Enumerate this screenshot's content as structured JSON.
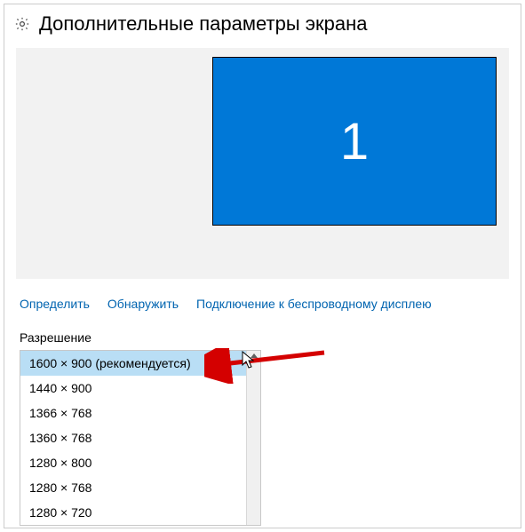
{
  "header": {
    "title": "Дополнительные параметры экрана"
  },
  "preview": {
    "monitor_number": "1"
  },
  "links": {
    "identify": "Определить",
    "detect": "Обнаружить",
    "wireless": "Подключение к беспроводному дисплею"
  },
  "resolution": {
    "label": "Разрешение",
    "selected_index": 0,
    "options": [
      "1600 × 900 (рекомендуется)",
      "1440 × 900",
      "1366 × 768",
      "1360 × 768",
      "1280 × 800",
      "1280 × 768",
      "1280 × 720"
    ]
  },
  "colors": {
    "accent": "#0078d7",
    "link": "#0064b0",
    "highlight": "#b9def5"
  }
}
